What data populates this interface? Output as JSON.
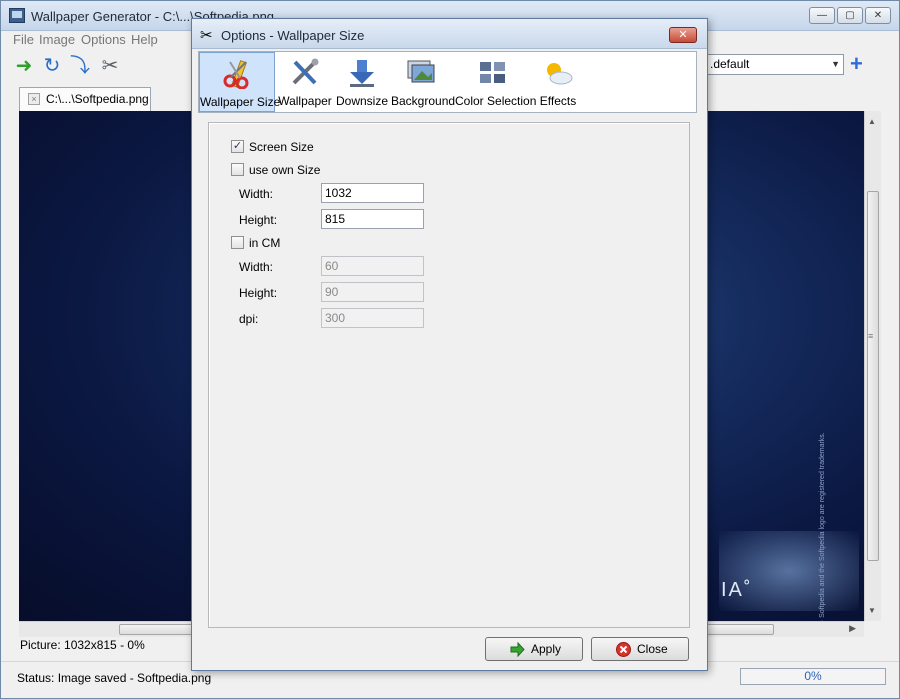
{
  "main_window": {
    "title": "Wallpaper Generator - C:\\...\\Softpedia.png",
    "window_buttons": {
      "minimize": "—",
      "maximize": "▢",
      "close": "✕"
    }
  },
  "menu": [
    "File",
    "Image",
    "Options",
    "Help"
  ],
  "toolbar": {
    "icons": [
      "go-icon",
      "refresh-icon",
      "save-icon",
      "tools-icon"
    ],
    "preset_value": ".default"
  },
  "document_tab": {
    "label": "C:\\...\\Softpedia.png"
  },
  "picture_info": "Picture: 1032x815 - 0%",
  "status": {
    "text": "Status:   Image saved - Softpedia.png",
    "progress_text": "0%",
    "progress_value": 0
  },
  "dialog": {
    "title": "Options - Wallpaper Size",
    "categories": [
      {
        "label": "Wallpaper Size",
        "icon": "scissors-ruler-icon",
        "selected": true
      },
      {
        "label": "Wallpaper",
        "icon": "tools-icon",
        "selected": false
      },
      {
        "label": "Downsize",
        "icon": "download-arrow-icon",
        "selected": false
      },
      {
        "label": "Background",
        "icon": "pictures-icon",
        "selected": false
      },
      {
        "label": "Color Selection",
        "icon": "color-grid-icon",
        "selected": false
      },
      {
        "label": "Effects",
        "icon": "weather-icon",
        "selected": false
      }
    ],
    "screen_size": {
      "label": "Screen Size",
      "checked": true
    },
    "own_size": {
      "label": "use own Size",
      "checked": false,
      "width_label": "Width:",
      "width_value": "1032",
      "height_label": "Height:",
      "height_value": "815"
    },
    "in_cm": {
      "label": "in CM",
      "checked": false,
      "width_label": "Width:",
      "width_value": "60",
      "height_label": "Height:",
      "height_value": "90",
      "dpi_label": "dpi:",
      "dpi_value": "300"
    },
    "buttons": {
      "apply": "Apply",
      "close": "Close"
    }
  }
}
